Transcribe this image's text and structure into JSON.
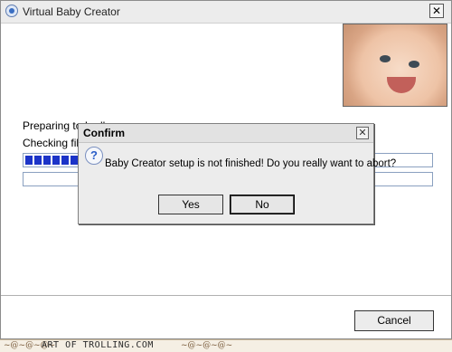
{
  "window": {
    "title": "Virtual Baby Creator",
    "close_glyph": "✕"
  },
  "installer": {
    "status_line_1": "Preparing to In",
    "status_line_1_trailing": "ll",
    "status_line_2": "Checking file",
    "progress_fraction": 0.13,
    "cancel_label": "Cancel"
  },
  "dialog": {
    "title": "Confirm",
    "close_glyph": "✕",
    "icon": "question-icon",
    "icon_glyph": "?",
    "message": "Baby Creator setup is not finished! Do you really want to abort?",
    "yes_label": "Yes",
    "no_label": "No"
  },
  "footer": {
    "watermark": "ART OF TROLLING.COM",
    "ornament": "~@~@~@~"
  },
  "colors": {
    "progress_fill": "#1c34c8",
    "dialog_bg": "#ececec"
  }
}
